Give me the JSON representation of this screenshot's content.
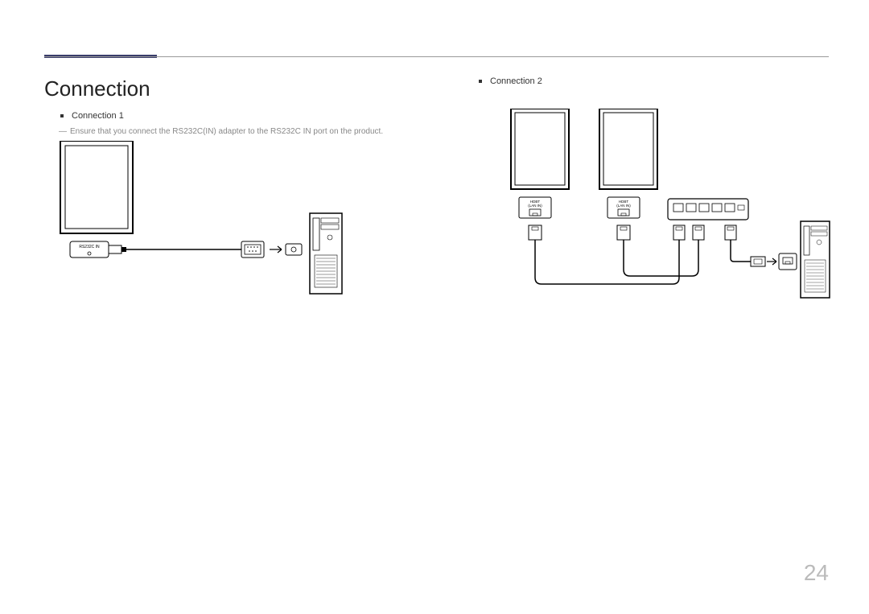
{
  "title": "Connection",
  "connection1": {
    "label": "Connection 1",
    "note": "Ensure that you connect the RS232C(IN) adapter to the RS232C IN port on the product.",
    "port_label": "RS232C IN"
  },
  "connection2": {
    "label": "Connection 2",
    "port_label_1": "HDBT (LAN IN)",
    "port_label_2": "HDBT (LAN IN)"
  },
  "page_number": "24"
}
